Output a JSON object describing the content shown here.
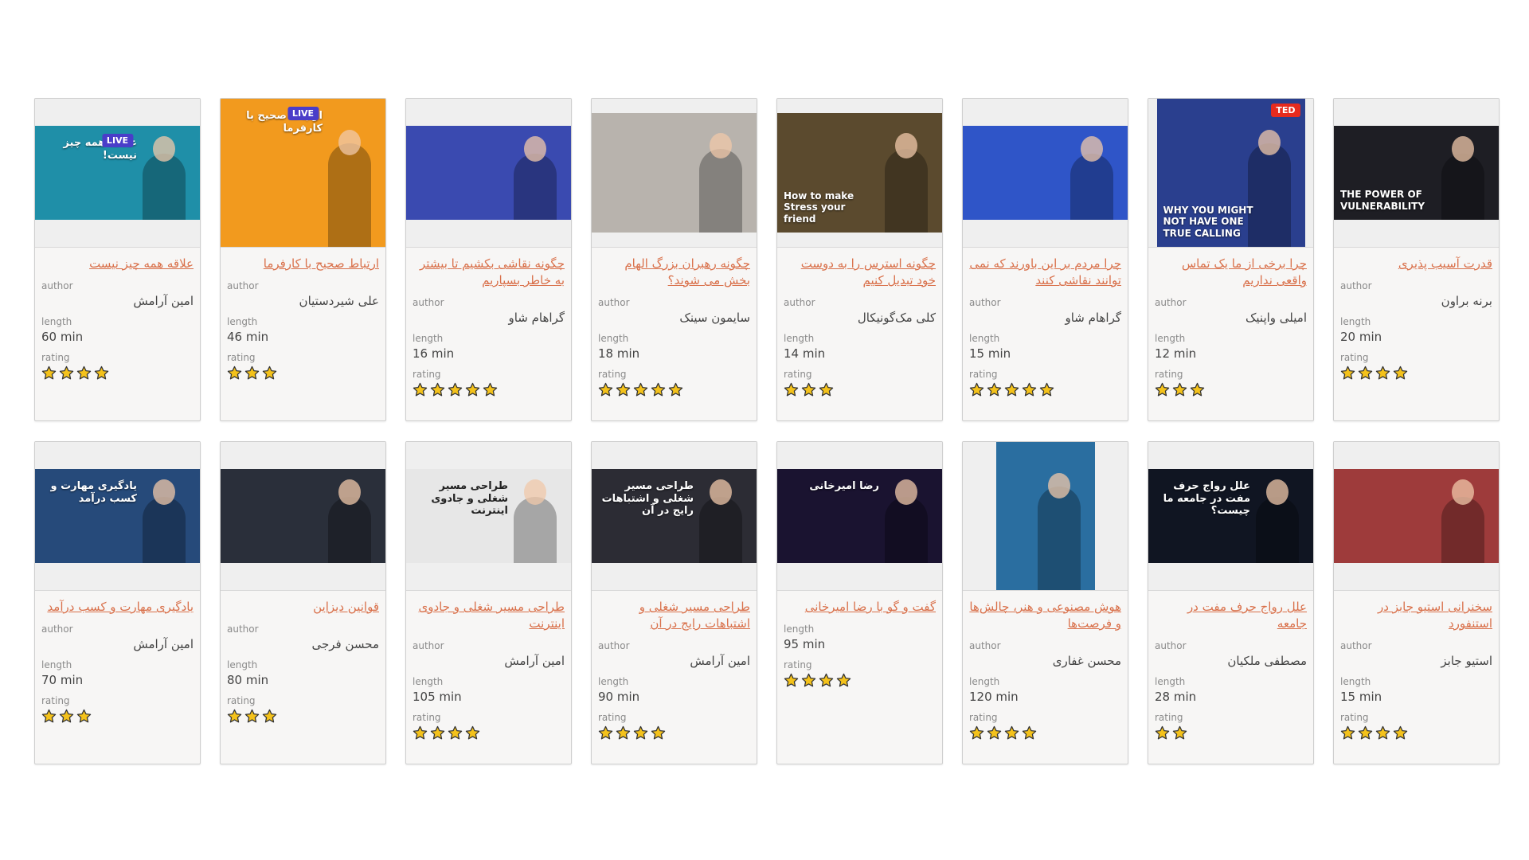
{
  "labels": {
    "author": "author",
    "length": "length",
    "rating": "rating"
  },
  "cards": [
    {
      "title": "علاقه همه چیز نیست",
      "author": "امین آرامش",
      "length": "60 min",
      "rating": 4,
      "thumb": {
        "bg": "#1f8fa8",
        "caption": "علاقه همه چیز نیست!",
        "badge": "LIVE",
        "style": "wide"
      }
    },
    {
      "title": "ارتباط صحیح با کارفرما",
      "author": "علی شیردستیان",
      "length": "46 min",
      "rating": 3,
      "thumb": {
        "bg": "#f29a1e",
        "caption": "ارتباط صحیح با کارفرما",
        "badge": "LIVE",
        "style": "tall"
      }
    },
    {
      "title": "چگونه نقاشی بکشیم تا بیشتر به خاطر بسپاریم",
      "author": "گراهام شاو",
      "length": "16 min",
      "rating": 5,
      "thumb": {
        "bg": "#3a4ab0",
        "caption": "",
        "badge": "",
        "style": "wide"
      }
    },
    {
      "title": "چگونه رهبران بزرگ الهام بخش می شوند؟",
      "author": "سایمون سینک",
      "length": "18 min",
      "rating": 5,
      "thumb": {
        "bg": "#b8b3ad",
        "caption": "",
        "badge": "",
        "style": "mid"
      }
    },
    {
      "title": "چگونه استرس را به دوست خود تبدیل کنیم",
      "author": "کلی مک‌گونیکال",
      "length": "14 min",
      "rating": 3,
      "thumb": {
        "bg": "#5b4a2e",
        "caption": "How to make Stress your friend",
        "badge": "",
        "style": "mid"
      }
    },
    {
      "title": "چرا مردم بر این باورند که نمی توانند نقاشی کنند",
      "author": "گراهام شاو",
      "length": "15 min",
      "rating": 5,
      "thumb": {
        "bg": "#2f55c8",
        "caption": "",
        "badge": "",
        "style": "wide"
      }
    },
    {
      "title": "چرا برخی از ما یک تماس واقعی نداریم",
      "author": "امیلی واپنیک",
      "length": "12 min",
      "rating": 3,
      "thumb": {
        "bg": "#2a3f8e",
        "caption": "WHY YOU MIGHT NOT HAVE ONE TRUE CALLING",
        "badge": "TED",
        "style": "tall-narrow"
      }
    },
    {
      "title": "قدرت آسیب پذیری",
      "author": "برنه براون",
      "length": "20 min",
      "rating": 4,
      "thumb": {
        "bg": "#1e1e24",
        "caption": "THE POWER OF VULNERABILITY",
        "badge": "",
        "style": "wide"
      }
    },
    {
      "title": "یادگیری مهارت و کسب درآمد",
      "author": "امین آرامش",
      "length": "70 min",
      "rating": 3,
      "thumb": {
        "bg": "#264a7a",
        "caption": "یادگیری مهارت و کسب درآمد",
        "badge": "",
        "style": "wide"
      }
    },
    {
      "title": "قوانین دیزاین",
      "author": "محسن فرجی",
      "length": "80 min",
      "rating": 3,
      "thumb": {
        "bg": "#2a2f3a",
        "caption": "",
        "badge": "",
        "style": "wide"
      }
    },
    {
      "title": "طراحی مسیر شغلی و جادوی اینترنت",
      "author": "امین آرامش",
      "length": "105 min",
      "rating": 4,
      "thumb": {
        "bg": "#e7e7e7",
        "caption": "طراحی مسیر شغلی و جادوی اینترنت",
        "badge": "",
        "style": "wide",
        "dark_text": true
      }
    },
    {
      "title": "طراحی مسیر شغلی و اشتباهات رایج در آن",
      "author": "امین آرامش",
      "length": "90 min",
      "rating": 4,
      "thumb": {
        "bg": "#2c2c34",
        "caption": "طراحی مسیر شغلی و اشتباهات رایج در آن",
        "badge": "",
        "style": "wide"
      }
    },
    {
      "title": "گفت و گو با رضا امیرخانی",
      "author": "",
      "length": "95 min",
      "rating": 4,
      "thumb": {
        "bg": "#1a1330",
        "caption": "رضا امیرخانی",
        "badge": "",
        "style": "wide"
      }
    },
    {
      "title": "هوش مصنوعی و هنر، چالش‌ها و فرصت‌ها",
      "author": "محسن غفاری",
      "length": "120 min",
      "rating": 4,
      "thumb": {
        "bg": "#2a6ea0",
        "caption": "",
        "badge": "",
        "style": "portrait"
      }
    },
    {
      "title": "علل رواج حرف مفت در جامعه",
      "author": "مصطفی ملکیان",
      "length": "28 min",
      "rating": 2,
      "thumb": {
        "bg": "#101522",
        "caption": "علل رواج حرف مفت در جامعه ما چیست؟",
        "badge": "",
        "style": "wide"
      }
    },
    {
      "title": "سخنرانی استیو جابز در استنفورد",
      "author": "استیو جابز",
      "length": "15 min",
      "rating": 4,
      "thumb": {
        "bg": "#9e3b3b",
        "caption": "",
        "badge": "",
        "style": "wide"
      }
    }
  ]
}
